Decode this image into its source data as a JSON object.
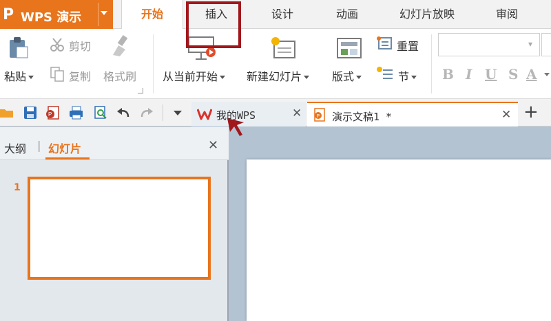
{
  "app": {
    "logo_glyph": "P",
    "name": "WPS 演示"
  },
  "tabs": [
    {
      "label": "开始",
      "active": true
    },
    {
      "label": "插入"
    },
    {
      "label": "设计"
    },
    {
      "label": "动画"
    },
    {
      "label": "幻灯片放映"
    },
    {
      "label": "审阅"
    }
  ],
  "ribbon": {
    "paste": "粘贴",
    "cut": "剪切",
    "copy": "复制",
    "format_painter": "格式刷",
    "from_current": "从当前开始",
    "new_slide": "新建幻灯片",
    "layout": "版式",
    "reset": "重置",
    "section": "节",
    "font_size_arrow": "▾",
    "format_buttons": [
      "B",
      "I",
      "U",
      "S",
      "A"
    ]
  },
  "doc_tabs": [
    {
      "label": "我的WPS",
      "close": "✕"
    },
    {
      "label": "演示文稿1 *",
      "close": "✕"
    }
  ],
  "new_tab": "+",
  "panel": {
    "tab_outline": "大纲",
    "divider": "|",
    "tab_slides": "幻灯片",
    "close": "✕",
    "slide_number": "1"
  },
  "colors": {
    "accent": "#e8741c",
    "highlight_box": "#a0171c"
  }
}
